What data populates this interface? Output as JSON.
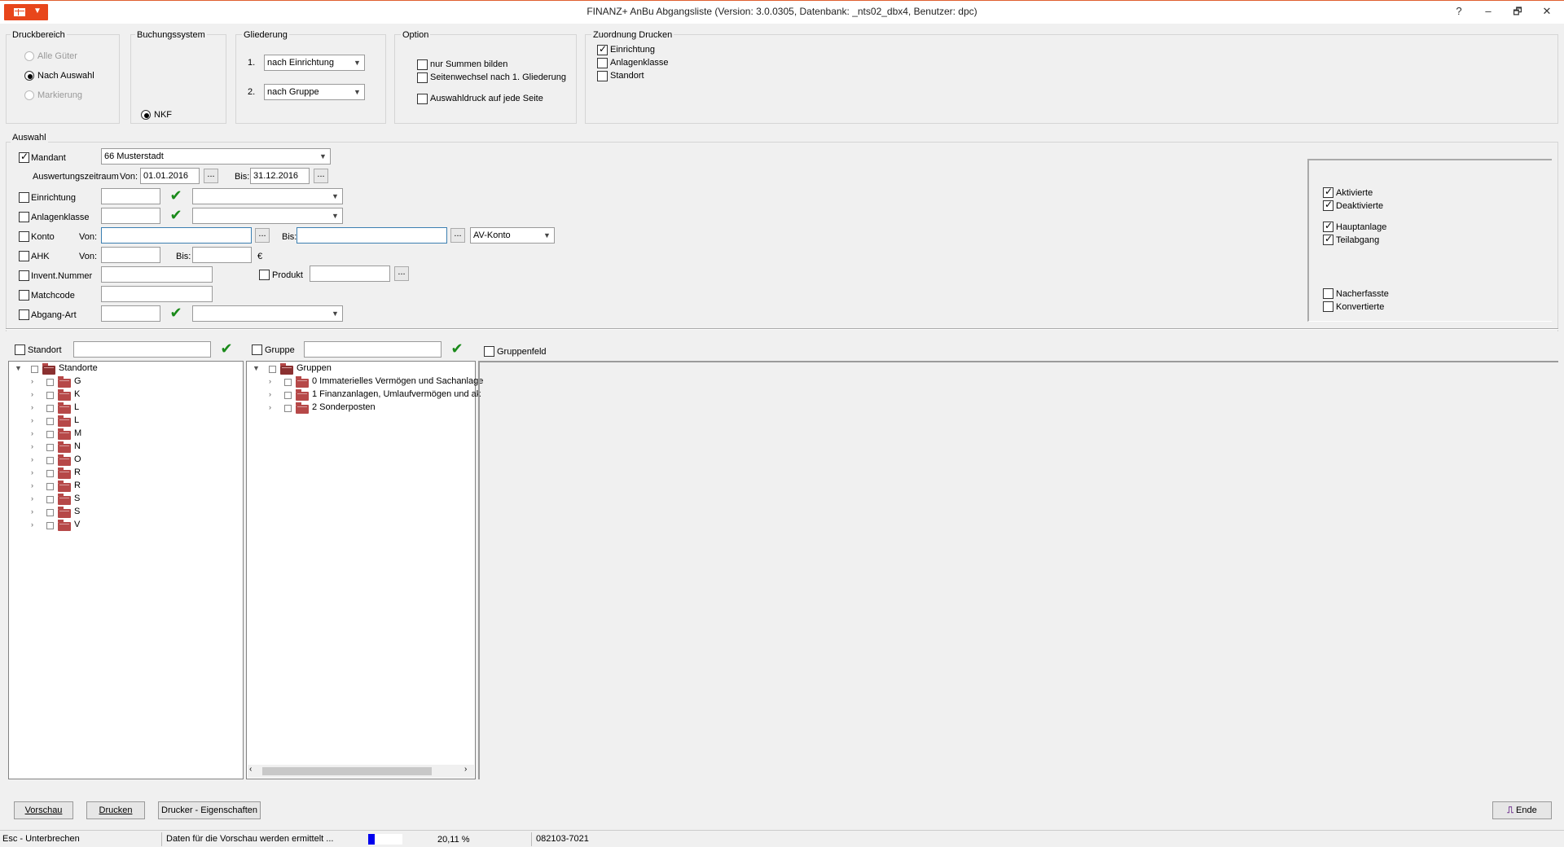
{
  "window": {
    "title": "FINANZ+ AnBu Abgangsliste (Version: 3.0.0305, Datenbank:            _nts02_dbx4, Benutzer: dpc)",
    "help": "?",
    "minimize": "–",
    "restore": "🗗",
    "close": "✕"
  },
  "druckbereich": {
    "label": "Druckbereich",
    "options": [
      "Alle Güter",
      "Nach Auswahl",
      "Markierung"
    ],
    "selected": "Nach Auswahl"
  },
  "buchungssystem": {
    "label": "Buchungssystem",
    "option": "NKF"
  },
  "gliederung": {
    "label": "Gliederung",
    "row1_num": "1.",
    "row1_value": "nach Einrichtung",
    "row2_num": "2.",
    "row2_value": "nach Gruppe"
  },
  "option": {
    "label": "Option",
    "items": [
      "nur Summen bilden",
      "Seitenwechsel nach 1. Gliederung",
      "Auswahldruck auf jede Seite"
    ]
  },
  "zuordnung": {
    "label": "Zuordnung Drucken",
    "items": [
      {
        "label": "Einrichtung",
        "checked": true
      },
      {
        "label": "Anlagenklasse",
        "checked": false
      },
      {
        "label": "Standort",
        "checked": false
      }
    ]
  },
  "auswahl": {
    "label": "Auswahl",
    "mandant_label": "Mandant",
    "mandant_value": "66 Musterstadt",
    "zeitraum_label": "Auswertungszeitraum",
    "von_label": "Von:",
    "von_value": "01.01.2016",
    "bis_label": "Bis:",
    "bis_value": "31.12.2016",
    "einrichtung_label": "Einrichtung",
    "anlagenklasse_label": "Anlagenklasse",
    "konto_label": "Konto",
    "konto_von": "Von:",
    "konto_bis": "Bis:",
    "konto_type": "AV-Konto",
    "ahk_label": "AHK",
    "ahk_von": "Von:",
    "ahk_bis": "Bis:",
    "ahk_unit": "€",
    "invent_label": "Invent.Nummer",
    "produkt_label": "Produkt",
    "matchcode_label": "Matchcode",
    "abgang_label": "Abgang-Art",
    "dots": "..."
  },
  "status_filters": {
    "group1": [
      {
        "label": "Aktivierte",
        "checked": true
      },
      {
        "label": "Deaktivierte",
        "checked": true
      }
    ],
    "group2": [
      {
        "label": "Hauptanlage",
        "checked": true
      },
      {
        "label": "Teilabgang",
        "checked": true
      }
    ],
    "group3": [
      {
        "label": "Nacherfasste",
        "checked": false
      },
      {
        "label": "Konvertierte",
        "checked": false
      }
    ]
  },
  "filters_row": {
    "standort_label": "Standort",
    "gruppe_label": "Gruppe",
    "gruppenfeld_label": "Gruppenfeld"
  },
  "tree_standorte": {
    "root": "Standorte",
    "items": [
      "G",
      "K",
      "L",
      "L",
      "M",
      "N",
      "O",
      "R",
      "R",
      "S",
      "S",
      "V"
    ]
  },
  "tree_gruppen": {
    "root": "Gruppen",
    "items": [
      "0 Immaterielles Vermögen und Sachanlage",
      "1 Finanzanlagen, Umlaufvermögen und ak",
      "2 Sonderposten"
    ]
  },
  "buttons": {
    "vorschau": "Vorschau",
    "drucken": "Drucken",
    "drucker": "Drucker - Eigenschaften",
    "ende": "Ende"
  },
  "statusbar": {
    "esc": "Esc - Unterbrechen",
    "message": "Daten für die Vorschau werden ermittelt ...",
    "progress": 0.2011,
    "percent": "20,11 %",
    "code": "082103-7021"
  },
  "colors": {
    "accent": "#e8461b",
    "progress": "#0000ee",
    "check_green": "#1a8a1a"
  }
}
